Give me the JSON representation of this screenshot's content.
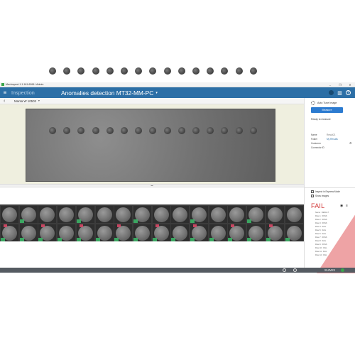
{
  "window": {
    "title": "MaxInspect 1.1.161.6096 / Admin",
    "buttons": [
      "–",
      "❐",
      "✕"
    ]
  },
  "header": {
    "section": "Inspection",
    "page_title": "Anomalies detection MT32-MM-PC",
    "icons": [
      "user-icon",
      "library-icon",
      "help-icon"
    ]
  },
  "subbar": {
    "camera": "Manta W 10503"
  },
  "panel": {
    "auto_tune": "Auto Tune Image",
    "measure": "Measure",
    "status": "Ready to measure",
    "fields": [
      {
        "key": "Name",
        "value": "Result21",
        "link": false
      },
      {
        "key": "Folder",
        "value": "My Results",
        "link": true
      },
      {
        "key": "Customer",
        "value": "",
        "link": false
      },
      {
        "key": "Connector ID",
        "value": "",
        "link": false
      }
    ],
    "express_mode": "Inspect in Express Mode",
    "show_images": "Show images",
    "result": "FAIL",
    "flaws": [
      "Name : RESULT",
      "Flaw 1 : PASS",
      "Flaw 2 : PASS",
      "Flaw 3 : PASS",
      "Flaw 4 : FAIL",
      "Flaw 5 : FAIL",
      "Flaw 6 : FAIL",
      "Flaw 7 : PASS",
      "Flaw 8 : FAIL",
      "Flaw 9 : PASS",
      "Flaw 10 : FAIL",
      "Flaw 11 : FAIL",
      "Flaw 12 : FAIL"
    ]
  },
  "footer": {
    "brand": "SUMIX"
  },
  "colors": {
    "accent": "#2c6fa6",
    "fail": "#d23b3b",
    "pass": "#3dbb6a"
  }
}
